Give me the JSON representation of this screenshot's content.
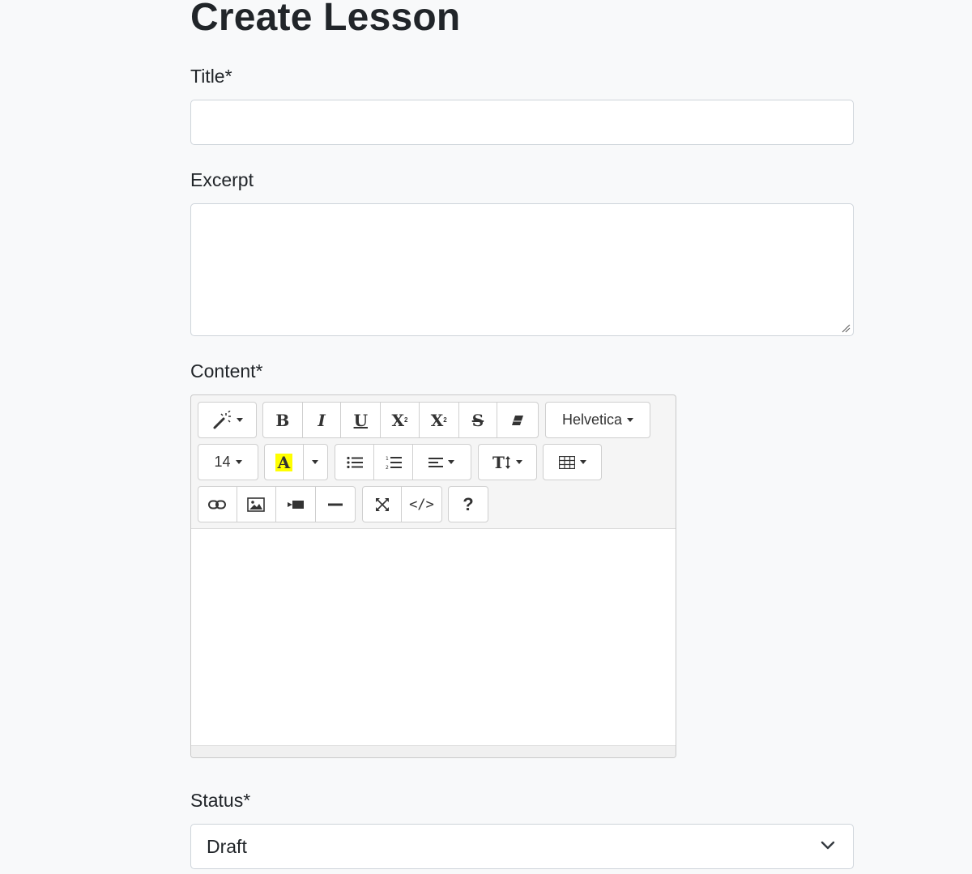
{
  "page": {
    "title": "Create Lesson"
  },
  "form": {
    "title_label": "Title*",
    "title_value": "",
    "excerpt_label": "Excerpt",
    "excerpt_value": "",
    "content_label": "Content*",
    "status_label": "Status*",
    "status_value": "Draft"
  },
  "editor": {
    "font_name": "Helvetica",
    "font_size": "14",
    "buttons": {
      "bold": "B",
      "italic": "I",
      "underline": "U",
      "superscript": "X",
      "subscript": "X",
      "strikethrough": "S",
      "highlight": "A",
      "line_height": "T",
      "code_view": "</>",
      "help": "?"
    },
    "highlight_color": "#ffff00"
  },
  "icons": [
    "magic-wand-icon",
    "eraser-icon",
    "unordered-list-icon",
    "ordered-list-icon",
    "align-icon",
    "table-icon",
    "link-icon",
    "picture-icon",
    "video-icon",
    "horizontal-rule-icon",
    "fullscreen-icon",
    "code-view-icon",
    "help-icon",
    "chevron-down-icon"
  ]
}
